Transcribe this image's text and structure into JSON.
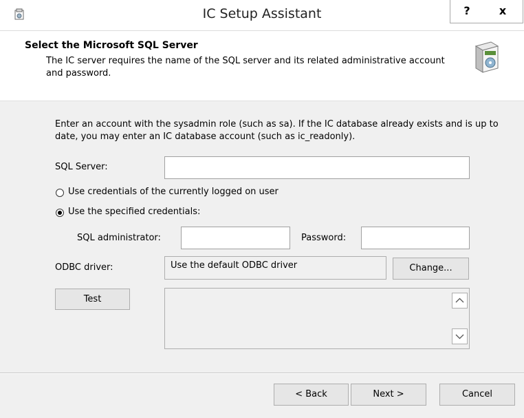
{
  "window": {
    "title": "IC Setup Assistant",
    "help_label": "?",
    "close_label": "x"
  },
  "header": {
    "title": "Select the Microsoft SQL Server",
    "subtitle": "The IC server requires the name of the SQL server and its related administrative account and password."
  },
  "form": {
    "instructions": "Enter an account with the sysadmin role (such as sa). If the IC database already exists and is up to date, you may enter an IC database account (such as ic_readonly).",
    "sql_server_label": "SQL Server:",
    "sql_server_value": "",
    "radio_current_user": "Use credentials of the currently logged on user",
    "radio_specified": "Use the specified credentials:",
    "selected_radio": "specified",
    "sql_admin_label": "SQL administrator:",
    "sql_admin_value": "",
    "password_label": "Password:",
    "password_value": "",
    "odbc_label": "ODBC driver:",
    "odbc_value": "Use the default ODBC driver",
    "change_label": "Change...",
    "test_label": "Test",
    "test_output": ""
  },
  "footer": {
    "back_label": "< Back",
    "next_label": "Next >",
    "cancel_label": "Cancel"
  },
  "icons": {
    "app": "setup-app-icon",
    "header": "software-box-icon",
    "scroll_up": "chevron-up-icon",
    "scroll_down": "chevron-down-icon"
  }
}
